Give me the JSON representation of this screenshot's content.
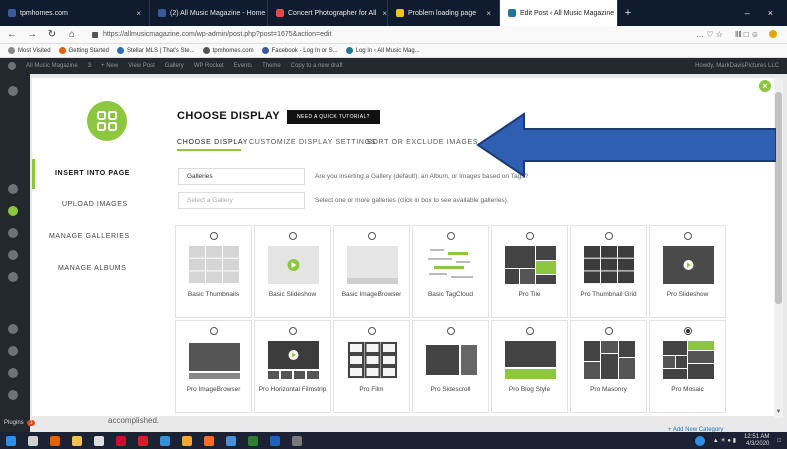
{
  "browser": {
    "tabs": [
      {
        "label": "tpmhomes.com",
        "color": "#3b5998",
        "active": false
      },
      {
        "label": "(2) All Music Magazine - Home",
        "color": "#3b5998",
        "active": false
      },
      {
        "label": "Concert Photographer for All",
        "color": "#e04a4a",
        "active": false
      },
      {
        "label": "Problem loading page",
        "color": "#f0c419",
        "active": false
      },
      {
        "label": "Edit Post ‹ All Music Magazine",
        "color": "#21759b",
        "active": true
      }
    ],
    "new_tab": "+",
    "win_minimize": "–",
    "win_close": "×",
    "url": "https://allmusicmagazine.com/wp-admin/post.php?post=1675&action=edit",
    "nav_back": "←",
    "nav_forward": "→",
    "nav_reload": "↻",
    "nav_home": "⌂",
    "nav_right_icons": "…  ♡  ☆",
    "tool_icons": "‖‖  □  ☺"
  },
  "bookmarks": [
    {
      "label": "Most Visited",
      "color": "#888"
    },
    {
      "label": "Getting Started",
      "color": "#e66000"
    },
    {
      "label": "Stellar MLS | That's Ste...",
      "color": "#2a6ebb"
    },
    {
      "label": "tpmhomes.com",
      "color": "#555"
    },
    {
      "label": "Facebook - Log In or S...",
      "color": "#3b5998"
    },
    {
      "label": "Log In ‹ All Music Mag...",
      "color": "#21759b"
    }
  ],
  "adminbar": {
    "items": [
      "All Music Magazine",
      "3",
      "+ New",
      "View Post",
      "Gallery",
      "WP Rocket",
      "Events",
      "Theme",
      "Copy to a new draft"
    ],
    "howdy": "Howdy, MarkDavisPictures LLC"
  },
  "modal": {
    "title": "CHOOSE DISPLAY",
    "tutorial_label": "NEED A QUICK TUTORIAL?",
    "close_label": "×",
    "menu": [
      {
        "label": "INSERT INTO PAGE",
        "active": true
      },
      {
        "label": "UPLOAD IMAGES",
        "active": false
      },
      {
        "label": "MANAGE GALLERIES",
        "active": false
      },
      {
        "label": "MANAGE ALBUMS",
        "active": false
      }
    ],
    "subtabs": [
      {
        "label": "CHOOSE DISPLAY",
        "active": true
      },
      {
        "label": "CUSTOMIZE DISPLAY SETTINGS",
        "active": false
      },
      {
        "label": "SORT OR EXCLUDE IMAGES",
        "active": false
      }
    ],
    "source_value": "Galleries",
    "source_help": "Are you inserting a Gallery (default), an Album, or Images based on Tags?",
    "gallery_placeholder": "Select a Gallery",
    "gallery_help": "Select one or more galleries (click in box to see available galleries).",
    "display_types": [
      {
        "label": "Basic Thumbnails",
        "thumb": "grid3",
        "selected": false
      },
      {
        "label": "Basic Slideshow",
        "thumb": "slide-light",
        "selected": false
      },
      {
        "label": "Basic ImageBrowser",
        "thumb": "browser-light",
        "selected": false
      },
      {
        "label": "Basic TagCloud",
        "thumb": "tagcloud",
        "selected": false
      },
      {
        "label": "Pro Tile",
        "thumb": "tile",
        "selected": false
      },
      {
        "label": "Pro Thumbnail Grid",
        "thumb": "grid-dark",
        "selected": false
      },
      {
        "label": "Pro Slideshow",
        "thumb": "slide-dark",
        "selected": false
      },
      {
        "label": "Pro ImageBrowser",
        "thumb": "browser-dark",
        "selected": false
      },
      {
        "label": "Pro Horizontal Filmstrip",
        "thumb": "filmstrip",
        "selected": false
      },
      {
        "label": "Pro Film",
        "thumb": "film",
        "selected": false
      },
      {
        "label": "Pro Sidescroll",
        "thumb": "sidescroll",
        "selected": false
      },
      {
        "label": "Pro Blog Style",
        "thumb": "blog",
        "selected": false
      },
      {
        "label": "Pro Masonry",
        "thumb": "masonry",
        "selected": false
      },
      {
        "label": "Pro Mosaic",
        "thumb": "mosaic",
        "selected": true
      }
    ]
  },
  "wp_sidebar": {
    "plugins_label": "Plugins",
    "plugins_badge": "1"
  },
  "background": {
    "text": "accomplished.",
    "link": "+ Add New Category"
  },
  "taskbar": {
    "time": "12:51 AM",
    "date": "4/3/2020"
  },
  "colors": {
    "accent": "#8dc63f",
    "arrow": "#2e5fb0",
    "arrow_outline": "#1a3a75"
  }
}
